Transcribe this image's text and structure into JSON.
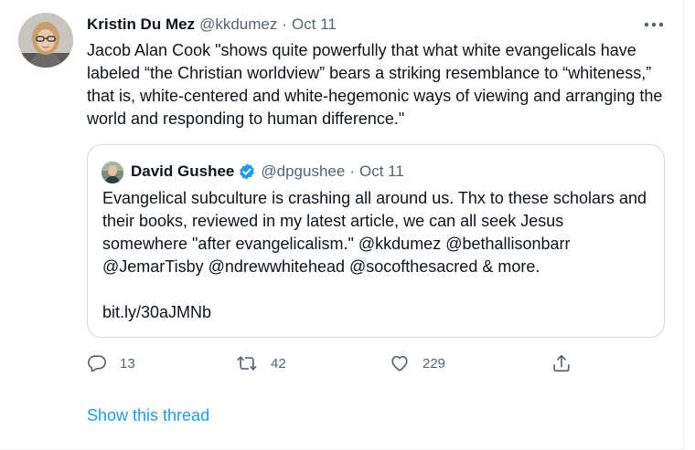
{
  "tweet": {
    "author": {
      "name": "Kristin Du Mez",
      "handle": "@kkdumez",
      "separator": "·",
      "date": "Oct 11"
    },
    "text": "Jacob Alan Cook \"shows quite powerfully that what white evangelicals have labeled “the Christian worldview” bears a striking resemblance to “whiteness,” that is, white-centered and white-hegemonic ways of viewing and arranging the world and responding to human difference.\"",
    "more_icon": "ellipsis-icon"
  },
  "quoted_tweet": {
    "author": {
      "name": "David Gushee",
      "verified_icon": "verified-badge-icon",
      "handle": "@dpgushee",
      "separator": "·",
      "date": "Oct 11"
    },
    "text": "Evangelical subculture is crashing all around us. Thx to these scholars and their books, reviewed in my latest article, we can all seek Jesus somewhere \"after evangelicalism.\" @kkdumez @bethallisonbarr @JemarTisby @ndrewwhitehead @socofthesacred & more.",
    "link": "bit.ly/30aJMNb"
  },
  "actions": {
    "reply": {
      "icon": "reply-icon",
      "count": "13"
    },
    "retweet": {
      "icon": "retweet-icon",
      "count": "42"
    },
    "like": {
      "icon": "heart-icon",
      "count": "229"
    },
    "share": {
      "icon": "share-icon"
    }
  },
  "show_thread": "Show this thread",
  "colors": {
    "link": "#1d9bf0",
    "muted": "#536471",
    "text": "#0f1419",
    "border": "#cfd9de",
    "verified": "#1d9bf0"
  }
}
